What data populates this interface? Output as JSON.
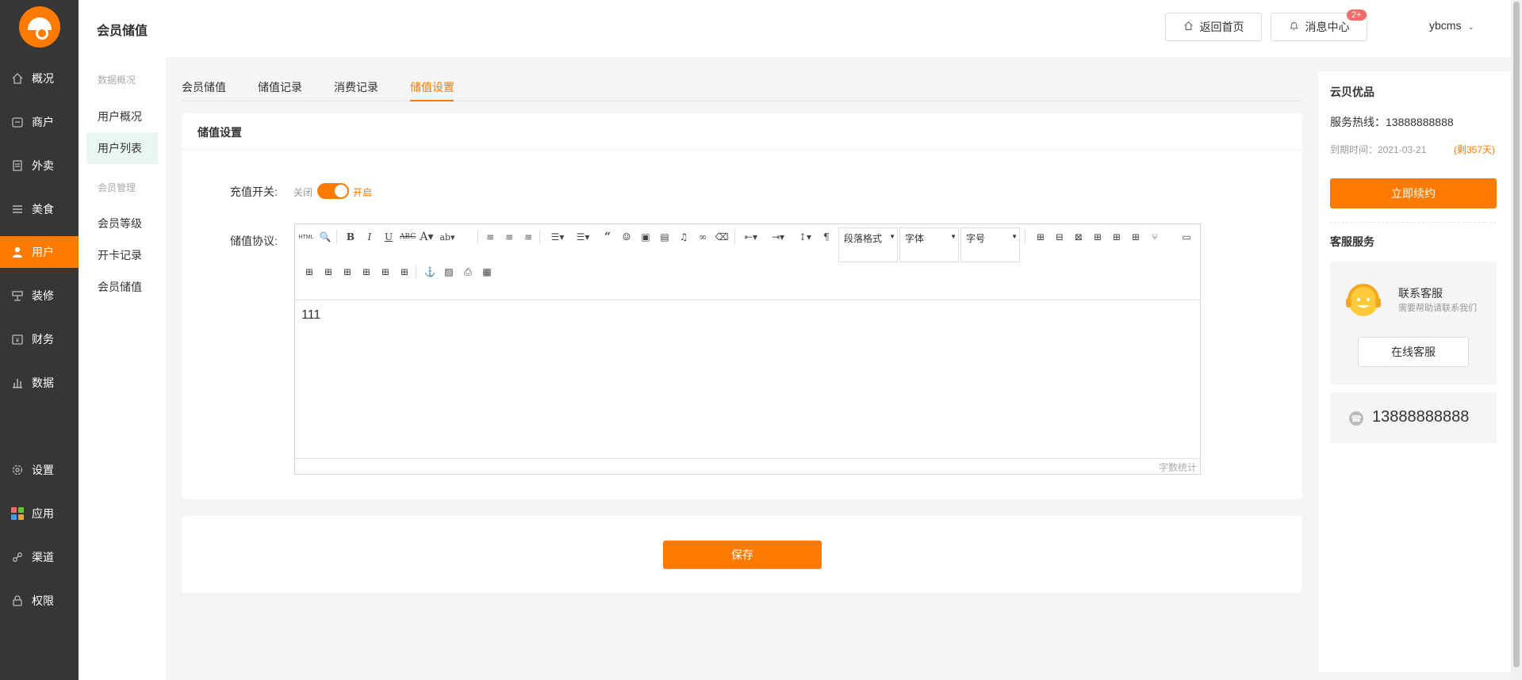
{
  "nav": {
    "items": [
      {
        "label": "概况",
        "icon": "home-icon"
      },
      {
        "label": "商户",
        "icon": "store-icon"
      },
      {
        "label": "外卖",
        "icon": "document-icon"
      },
      {
        "label": "美食",
        "icon": "menu-icon"
      },
      {
        "label": "用户",
        "icon": "user-icon",
        "active": true
      },
      {
        "label": "装修",
        "icon": "decor-icon"
      },
      {
        "label": "财务",
        "icon": "finance-icon"
      },
      {
        "label": "数据",
        "icon": "chart-icon"
      },
      {
        "label": "设置",
        "icon": "gear-icon"
      },
      {
        "label": "应用",
        "icon": "apps-icon"
      },
      {
        "label": "渠道",
        "icon": "channel-icon"
      },
      {
        "label": "权限",
        "icon": "lock-icon"
      }
    ]
  },
  "subnav": {
    "group1": "数据概况",
    "items1": [
      "用户概况",
      "用户列表"
    ],
    "group2": "会员管理",
    "items2": [
      "会员等级",
      "开卡记录",
      "会员储值"
    ]
  },
  "header": {
    "title": "会员储值",
    "home_button": "返回首页",
    "msg_button": "消息中心",
    "msg_badge": "2+",
    "username": "ybcms"
  },
  "tabs": [
    "会员储值",
    "储值记录",
    "消费记录",
    "储值设置"
  ],
  "active_tab": "储值设置",
  "settings": {
    "card_title": "储值设置",
    "recharge_label": "充值开关:",
    "switch_off": "关闭",
    "switch_on": "开启",
    "switch_value": true,
    "agreement_label": "储值协议:"
  },
  "editor": {
    "html_label": "HTML",
    "paragraph_select": "段落格式",
    "font_select": "字体",
    "size_select": "字号",
    "content": "111",
    "word_count": "字数统计"
  },
  "save_button": "保存",
  "right_panel": {
    "brand": "云贝优品",
    "hotline": "服务热线：13888888888",
    "expire": "到期时间：2021-03-21",
    "remaining": "(剩357天)",
    "renew_button": "立即续约",
    "service_title": "客服服务",
    "contact_title": "联系客服",
    "contact_sub": "需要帮助请联系我们",
    "online_button": "在线客服",
    "phone": "13888888888"
  },
  "colors": {
    "accent": "#ff7a00",
    "nav_bg": "#363636"
  }
}
